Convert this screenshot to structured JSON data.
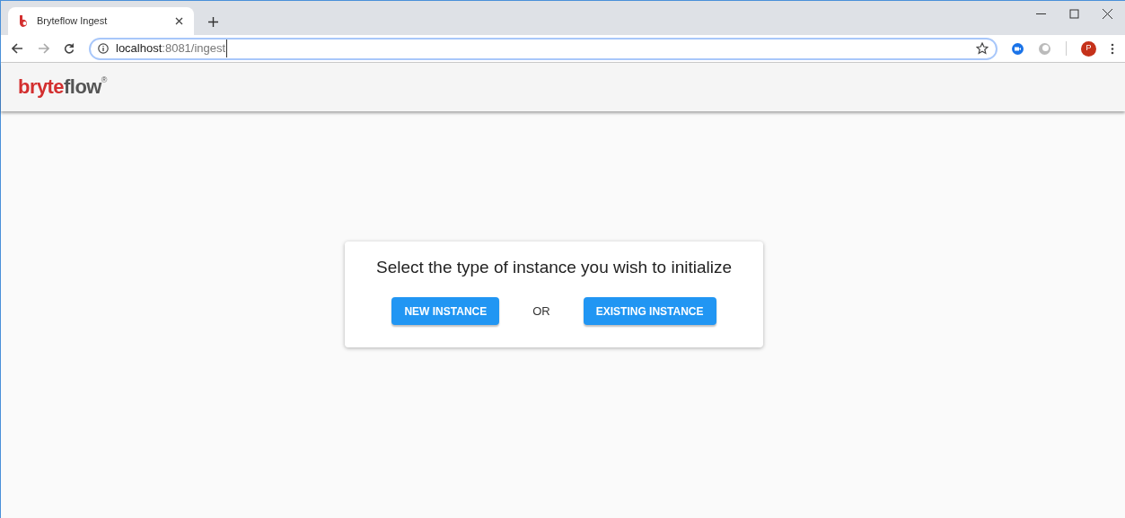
{
  "browser": {
    "tab": {
      "title": "Bryteflow Ingest",
      "selected": true
    },
    "url": {
      "host": "localhost",
      "path": ":8081/ingest"
    },
    "profile_initial": "P"
  },
  "header": {
    "logo": {
      "accent": "bryte",
      "rest": "flow",
      "mark": "®"
    }
  },
  "card": {
    "prompt": "Select the type of instance you wish to initialize",
    "separator": "OR",
    "buttons": [
      {
        "label": "NEW INSTANCE"
      },
      {
        "label": "EXISTING INSTANCE"
      }
    ]
  }
}
